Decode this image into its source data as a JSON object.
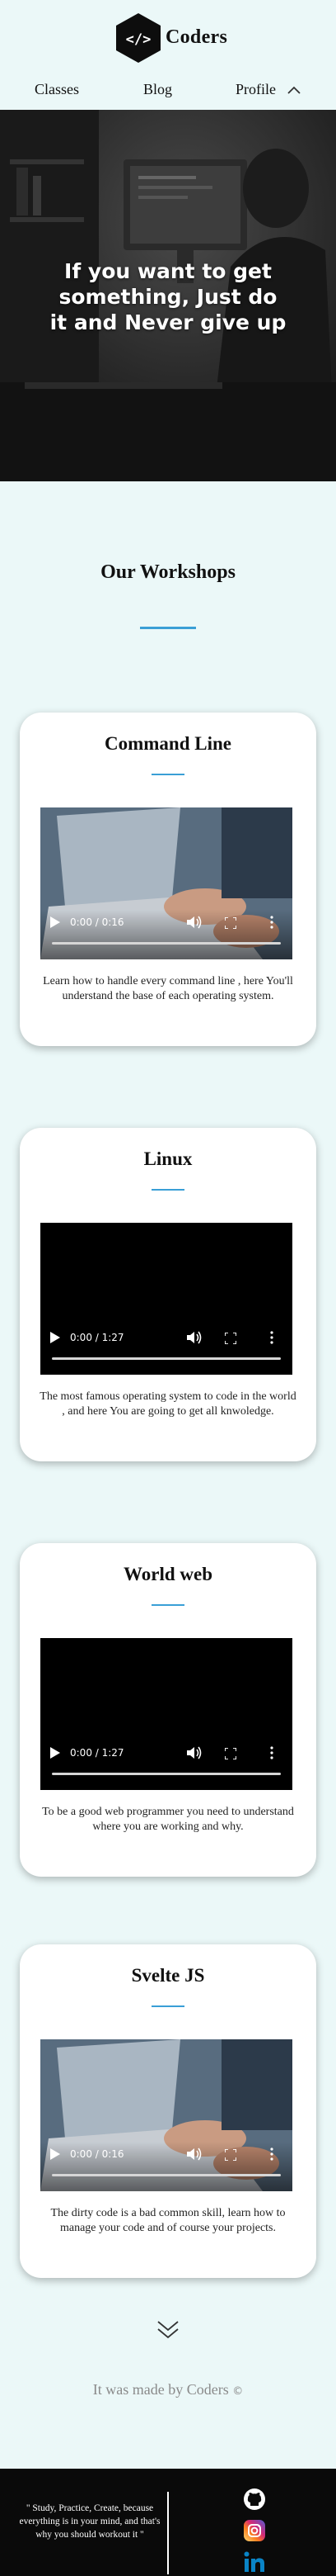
{
  "header": {
    "brand": "Coders",
    "logo_symbol": "</>",
    "nav": {
      "classes": "Classes",
      "blog": "Blog",
      "profile": "Profile"
    }
  },
  "hero": {
    "text": "If you want to get something, Just do it and Never give up"
  },
  "workshops": {
    "title": "Our Workshops",
    "accent_color": "#3a9fd6",
    "cards": [
      {
        "title": "Command Line",
        "time": "0:00 / 0:16",
        "description": "Learn how to handle every command line , here You'll understand the base of each operating system."
      },
      {
        "title": "Linux",
        "time": "0:00 / 1:27",
        "description": "The most famous operating system to code in the world , and here You are going to get all knwoledge."
      },
      {
        "title": "World web",
        "time": "0:00 / 1:27",
        "description": "To be a good web programmer you need to understand where you are working and why."
      },
      {
        "title": "Svelte JS",
        "time": "0:00 / 0:16",
        "description": "The dirty code is a bad common skill, learn how to manage your code and of course your projects."
      }
    ]
  },
  "made_by": {
    "text": "It was made by Coders",
    "symbol": "©"
  },
  "footer": {
    "quote": "\" Study, Practice, Create, because everything is in your mind, and that's why you should workout it \"",
    "social_icons": [
      "github-icon",
      "instagram-icon",
      "linkedin-icon"
    ]
  }
}
